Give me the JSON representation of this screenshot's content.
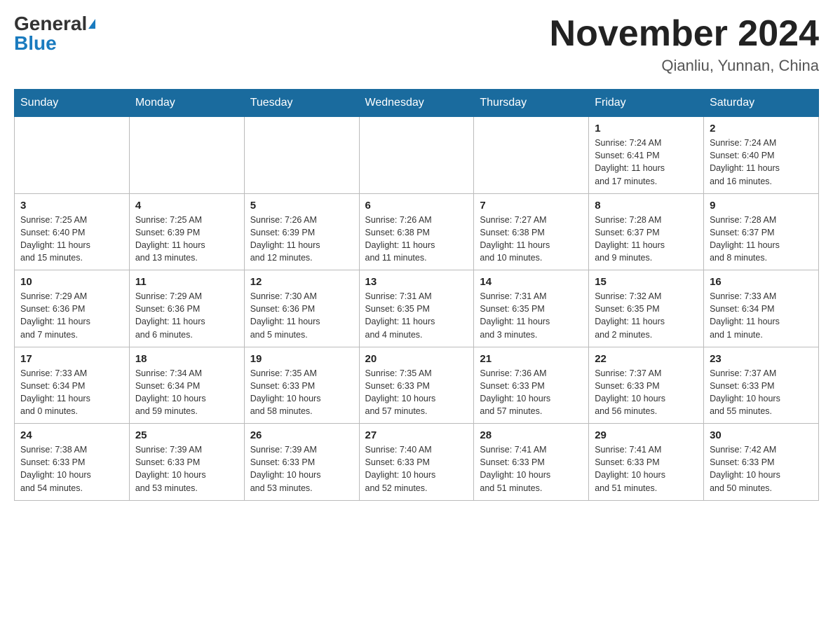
{
  "header": {
    "logo_general": "General",
    "logo_blue": "Blue",
    "month_title": "November 2024",
    "location": "Qianliu, Yunnan, China"
  },
  "weekdays": [
    "Sunday",
    "Monday",
    "Tuesday",
    "Wednesday",
    "Thursday",
    "Friday",
    "Saturday"
  ],
  "weeks": [
    [
      {
        "day": "",
        "info": ""
      },
      {
        "day": "",
        "info": ""
      },
      {
        "day": "",
        "info": ""
      },
      {
        "day": "",
        "info": ""
      },
      {
        "day": "",
        "info": ""
      },
      {
        "day": "1",
        "info": "Sunrise: 7:24 AM\nSunset: 6:41 PM\nDaylight: 11 hours\nand 17 minutes."
      },
      {
        "day": "2",
        "info": "Sunrise: 7:24 AM\nSunset: 6:40 PM\nDaylight: 11 hours\nand 16 minutes."
      }
    ],
    [
      {
        "day": "3",
        "info": "Sunrise: 7:25 AM\nSunset: 6:40 PM\nDaylight: 11 hours\nand 15 minutes."
      },
      {
        "day": "4",
        "info": "Sunrise: 7:25 AM\nSunset: 6:39 PM\nDaylight: 11 hours\nand 13 minutes."
      },
      {
        "day": "5",
        "info": "Sunrise: 7:26 AM\nSunset: 6:39 PM\nDaylight: 11 hours\nand 12 minutes."
      },
      {
        "day": "6",
        "info": "Sunrise: 7:26 AM\nSunset: 6:38 PM\nDaylight: 11 hours\nand 11 minutes."
      },
      {
        "day": "7",
        "info": "Sunrise: 7:27 AM\nSunset: 6:38 PM\nDaylight: 11 hours\nand 10 minutes."
      },
      {
        "day": "8",
        "info": "Sunrise: 7:28 AM\nSunset: 6:37 PM\nDaylight: 11 hours\nand 9 minutes."
      },
      {
        "day": "9",
        "info": "Sunrise: 7:28 AM\nSunset: 6:37 PM\nDaylight: 11 hours\nand 8 minutes."
      }
    ],
    [
      {
        "day": "10",
        "info": "Sunrise: 7:29 AM\nSunset: 6:36 PM\nDaylight: 11 hours\nand 7 minutes."
      },
      {
        "day": "11",
        "info": "Sunrise: 7:29 AM\nSunset: 6:36 PM\nDaylight: 11 hours\nand 6 minutes."
      },
      {
        "day": "12",
        "info": "Sunrise: 7:30 AM\nSunset: 6:36 PM\nDaylight: 11 hours\nand 5 minutes."
      },
      {
        "day": "13",
        "info": "Sunrise: 7:31 AM\nSunset: 6:35 PM\nDaylight: 11 hours\nand 4 minutes."
      },
      {
        "day": "14",
        "info": "Sunrise: 7:31 AM\nSunset: 6:35 PM\nDaylight: 11 hours\nand 3 minutes."
      },
      {
        "day": "15",
        "info": "Sunrise: 7:32 AM\nSunset: 6:35 PM\nDaylight: 11 hours\nand 2 minutes."
      },
      {
        "day": "16",
        "info": "Sunrise: 7:33 AM\nSunset: 6:34 PM\nDaylight: 11 hours\nand 1 minute."
      }
    ],
    [
      {
        "day": "17",
        "info": "Sunrise: 7:33 AM\nSunset: 6:34 PM\nDaylight: 11 hours\nand 0 minutes."
      },
      {
        "day": "18",
        "info": "Sunrise: 7:34 AM\nSunset: 6:34 PM\nDaylight: 10 hours\nand 59 minutes."
      },
      {
        "day": "19",
        "info": "Sunrise: 7:35 AM\nSunset: 6:33 PM\nDaylight: 10 hours\nand 58 minutes."
      },
      {
        "day": "20",
        "info": "Sunrise: 7:35 AM\nSunset: 6:33 PM\nDaylight: 10 hours\nand 57 minutes."
      },
      {
        "day": "21",
        "info": "Sunrise: 7:36 AM\nSunset: 6:33 PM\nDaylight: 10 hours\nand 57 minutes."
      },
      {
        "day": "22",
        "info": "Sunrise: 7:37 AM\nSunset: 6:33 PM\nDaylight: 10 hours\nand 56 minutes."
      },
      {
        "day": "23",
        "info": "Sunrise: 7:37 AM\nSunset: 6:33 PM\nDaylight: 10 hours\nand 55 minutes."
      }
    ],
    [
      {
        "day": "24",
        "info": "Sunrise: 7:38 AM\nSunset: 6:33 PM\nDaylight: 10 hours\nand 54 minutes."
      },
      {
        "day": "25",
        "info": "Sunrise: 7:39 AM\nSunset: 6:33 PM\nDaylight: 10 hours\nand 53 minutes."
      },
      {
        "day": "26",
        "info": "Sunrise: 7:39 AM\nSunset: 6:33 PM\nDaylight: 10 hours\nand 53 minutes."
      },
      {
        "day": "27",
        "info": "Sunrise: 7:40 AM\nSunset: 6:33 PM\nDaylight: 10 hours\nand 52 minutes."
      },
      {
        "day": "28",
        "info": "Sunrise: 7:41 AM\nSunset: 6:33 PM\nDaylight: 10 hours\nand 51 minutes."
      },
      {
        "day": "29",
        "info": "Sunrise: 7:41 AM\nSunset: 6:33 PM\nDaylight: 10 hours\nand 51 minutes."
      },
      {
        "day": "30",
        "info": "Sunrise: 7:42 AM\nSunset: 6:33 PM\nDaylight: 10 hours\nand 50 minutes."
      }
    ]
  ]
}
